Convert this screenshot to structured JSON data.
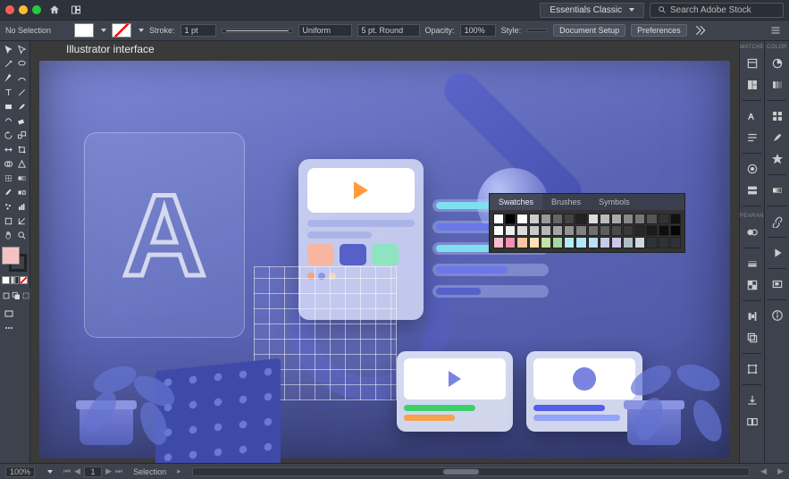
{
  "titlebar": {
    "workspace_label": "Essentials Classic",
    "search_placeholder": "Search Adobe Stock"
  },
  "controlbar": {
    "no_selection": "No Selection",
    "stroke_label": "Stroke:",
    "stroke_weight": "1 pt",
    "stroke_profile": "Uniform",
    "stroke_brush": "5 pt. Round",
    "opacity_label": "Opacity:",
    "opacity_value": "100%",
    "style_label": "Style:",
    "doc_setup": "Document Setup",
    "prefs": "Preferences"
  },
  "document": {
    "tab_title": "Illustrator interface",
    "letter": "A"
  },
  "panels": {
    "left_group_top": "SWATCHES",
    "left_group_mid": "APPEARANCE",
    "right_group_top": "COLOR"
  },
  "flyout": {
    "tab1": "Swatches",
    "tab2": "Brushes",
    "tab3": "Symbols",
    "rows": [
      [
        "#ffffff",
        "#000000",
        "#fefefe",
        "#cccccc",
        "#999999",
        "#666666",
        "#444444",
        "#222222",
        "#dddddd",
        "#bbbbbb",
        "#aaaaaa",
        "#888888",
        "#777777",
        "#555555",
        "#333333",
        "#111111"
      ],
      [
        "#ffffff",
        "#eeeeee",
        "#dcdcdc",
        "#c9c9c9",
        "#b7b7b7",
        "#a5a5a5",
        "#939393",
        "#818181",
        "#6f6f6f",
        "#5d5d5d",
        "#4b4b4b",
        "#393939",
        "#272727",
        "#1a1a1a",
        "#0e0e0e",
        "#050505"
      ],
      [
        "#f8bbd0",
        "#f48fb1",
        "#fbc6a4",
        "#ffe0b2",
        "#c5e1a5",
        "#a5d6a7",
        "#b2ebf2",
        "#b3e5fc",
        "#bbdefb",
        "#c5cae9",
        "#d1c4e9",
        "#b0bec5",
        "#cfd8dc",
        "#2e323b",
        "#2e323b",
        "#2e323b"
      ]
    ]
  },
  "statusbar": {
    "zoom": "100%",
    "mode": "Selection"
  },
  "colors": {
    "fill_swatch": "#f4c2c2",
    "accent_orange": "#ff9c3a",
    "accent_blue": "#5560c8"
  }
}
